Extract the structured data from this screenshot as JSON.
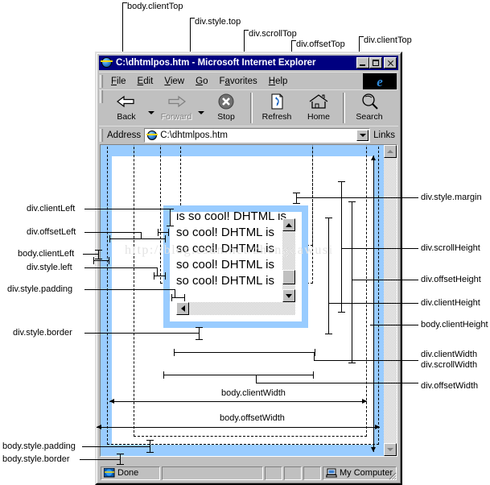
{
  "window": {
    "title": "C:\\dhtmlpos.htm - Microsoft Internet Explorer",
    "minimize_label": "Minimize",
    "maximize_label": "Maximize",
    "close_label": "Close"
  },
  "menu": {
    "items": [
      "File",
      "Edit",
      "View",
      "Go",
      "Favorites",
      "Help"
    ]
  },
  "toolbar": {
    "buttons": [
      {
        "label": "Back",
        "icon": "back-arrow-icon",
        "disabled": false
      },
      {
        "label": "Forward",
        "icon": "forward-arrow-icon",
        "disabled": true
      },
      {
        "label": "Stop",
        "icon": "stop-icon",
        "disabled": false
      },
      {
        "label": "Refresh",
        "icon": "refresh-icon",
        "disabled": false
      },
      {
        "label": "Home",
        "icon": "home-icon",
        "disabled": false
      },
      {
        "label": "Search",
        "icon": "search-icon",
        "disabled": false
      }
    ]
  },
  "address": {
    "label": "Address",
    "value": "C:\\dhtmlpos.htm",
    "placeholder": "",
    "links_label": "Links"
  },
  "status": {
    "text": "Done",
    "zone": "My Computer"
  },
  "page": {
    "div_text": "is so cool! DHTML is so cool! DHTML is so cool! DHTML is so cool! DHTML is so cool! DHTML is",
    "watermark": "http://blog.csdn.net/zhengdawusi",
    "body_border_color": "#99ccff",
    "div_border_color": "#99ccff"
  },
  "annotations": {
    "top": [
      {
        "id": "body-clientTop",
        "text": "body.clientTop"
      },
      {
        "id": "div-style-top",
        "text": "div.style.top"
      },
      {
        "id": "div-scrollTop",
        "text": "div.scrollTop"
      },
      {
        "id": "div-offsetTop",
        "text": "div.offsetTop"
      },
      {
        "id": "div-clientTop",
        "text": "div.clientTop"
      }
    ],
    "left": [
      {
        "id": "div-clientLeft",
        "text": "div.clientLeft"
      },
      {
        "id": "div-offsetLeft",
        "text": "div.offsetLeft"
      },
      {
        "id": "body-clientLeft",
        "text": "body.clientLeft"
      },
      {
        "id": "div-style-left",
        "text": "div.style.left"
      },
      {
        "id": "div-style-padding",
        "text": "div.style.padding"
      },
      {
        "id": "div-style-border",
        "text": "div.style.border"
      },
      {
        "id": "body-style-padding",
        "text": "body.style.padding"
      },
      {
        "id": "body-style-border",
        "text": "body.style.border"
      }
    ],
    "right": [
      {
        "id": "div-style-margin",
        "text": "div.style.margin"
      },
      {
        "id": "div-scrollHeight",
        "text": "div.scrollHeight"
      },
      {
        "id": "div-offsetHeight",
        "text": "div.offsetHeight"
      },
      {
        "id": "div-clientHeight",
        "text": "div.clientHeight"
      },
      {
        "id": "body-clientHeight",
        "text": "body.clientHeight"
      },
      {
        "id": "div-clientWidth",
        "text": "div.clientWidth"
      },
      {
        "id": "div-scrollWidth",
        "text": "div.scrollWidth"
      },
      {
        "id": "div-offsetWidth",
        "text": "div.offsetWidth"
      }
    ],
    "inner": [
      {
        "id": "body-clientWidth",
        "text": "body.clientWidth"
      },
      {
        "id": "body-offsetWidth",
        "text": "body.offsetWidth"
      }
    ]
  }
}
